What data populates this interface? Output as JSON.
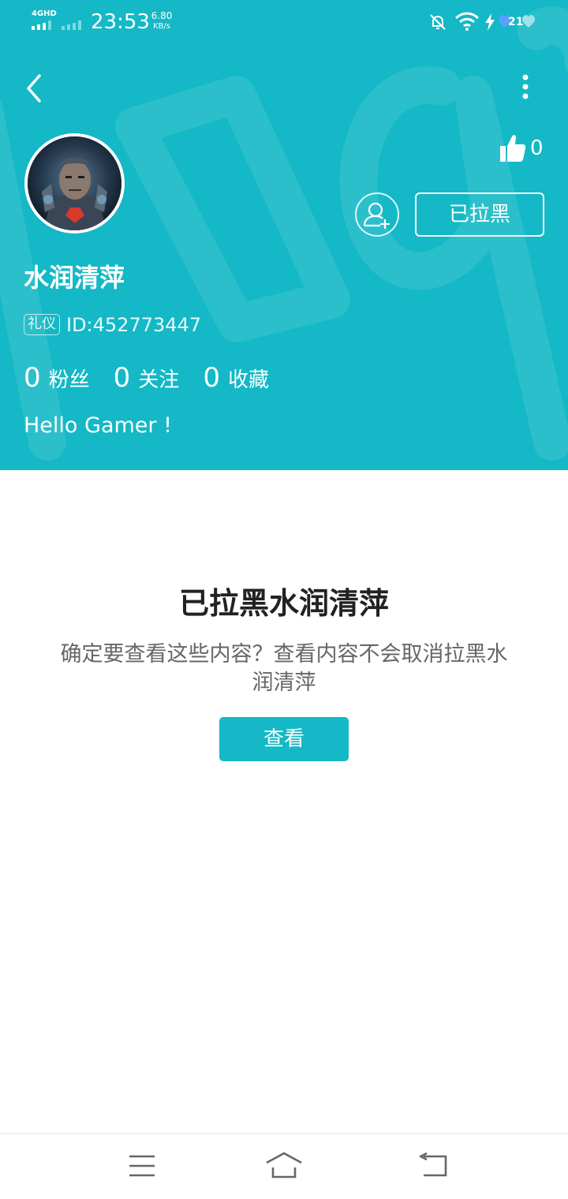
{
  "status_bar": {
    "network": "4GHD",
    "time": "23:53",
    "speed_value": "6.80",
    "speed_unit": "KB/s",
    "battery": "21",
    "icons": [
      "signal-icon",
      "bell-muted-icon",
      "wifi-icon",
      "charging-icon",
      "battery-icon"
    ]
  },
  "header": {
    "back_icon": "back-arrow-icon",
    "more_icon": "more-vertical-icon",
    "like_count": "0",
    "follow_icon": "add-user-icon",
    "blocked_label": "已拉黑",
    "username": "水润清萍",
    "tag": "礼仪",
    "user_id": "ID:452773447",
    "stats": [
      {
        "value": "0",
        "label": "粉丝"
      },
      {
        "value": "0",
        "label": "关注"
      },
      {
        "value": "0",
        "label": "收藏"
      }
    ],
    "bio": "Hello Gamer !"
  },
  "content": {
    "title": "已拉黑水润清萍",
    "description": "确定要查看这些内容？查看内容不会取消拉黑水润清萍",
    "view_button": "查看"
  },
  "nav_bar": {
    "icons": [
      "menu-icon",
      "home-icon",
      "back-icon"
    ]
  },
  "colors": {
    "accent": "#14b8c6",
    "title_text": "#222222",
    "body_text": "#666666"
  }
}
